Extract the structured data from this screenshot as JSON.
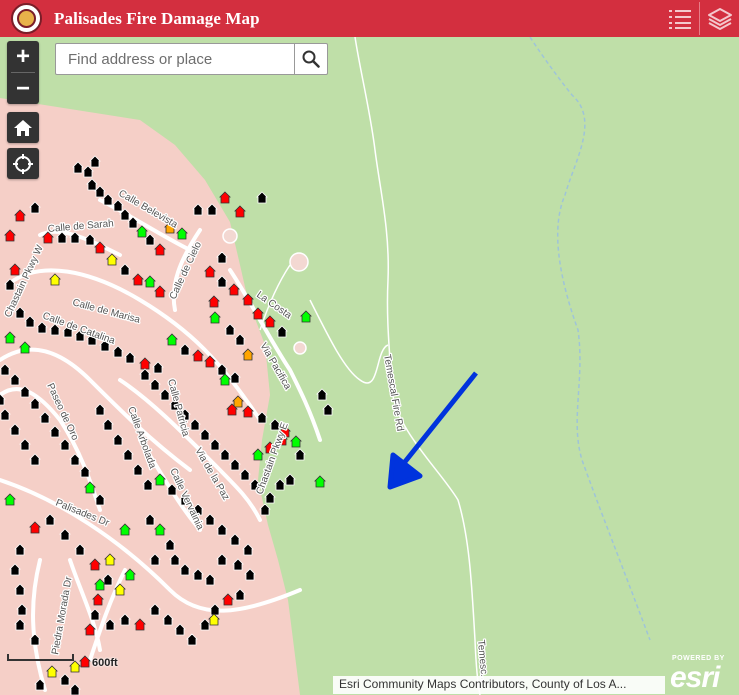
{
  "header": {
    "title": "Palisades Fire Damage Map",
    "bg_color": "#d32f3f",
    "logo_icon": "city-seal-icon",
    "legend_icon": "legend-list-icon",
    "layers_icon": "layers-icon"
  },
  "search": {
    "placeholder": "Find address or place",
    "value": ""
  },
  "controls": {
    "zoom_in": "+",
    "zoom_out": "−",
    "home_icon": "home-icon",
    "locate_icon": "locate-icon"
  },
  "streets": {
    "calle_belevista": "Calle Belevista",
    "calle_de_sarah": "Calle de Sarah",
    "calle_de_cielo": "Calle de Cielo",
    "la_costa": "La Costa",
    "via_pacifica": "Via Pacifica",
    "temescal_fire_rd": "Temescal Fire Rd",
    "temescal": "Temesc...",
    "paseo_de_oro": "Paseo de Oro",
    "calle_arbolada": "Calle Arbolada",
    "palisades_dr": "Palisades Dr",
    "piedra_morada_dr": "Piedra Morada Dr",
    "chastain_pkwy_e": "Chastain Pkwy E",
    "calle_patricia": "Calle Patricia",
    "calle_vervainia": "Calle Vervainia",
    "via_de_la_paz": "Via de la Paz",
    "calle_de_marisa": "Calle de Marisa",
    "calle_de_catalina": "Calle de Catalina",
    "pkwy_w": "Chastain Pkwy W"
  },
  "scale": {
    "label": "600ft"
  },
  "attribution": "Esri Community Maps Contributors, County of Los A...",
  "powered_by": "POWERED BY",
  "esri": "esri",
  "legend_colors": {
    "destroyed": "#000000",
    "major": "#ff0000",
    "minor": "#ffa500",
    "affected": "#ffff00",
    "no_damage": "#00ff00"
  },
  "annotation": {
    "icon": "blue-arrow-icon",
    "color": "#0033dd"
  }
}
